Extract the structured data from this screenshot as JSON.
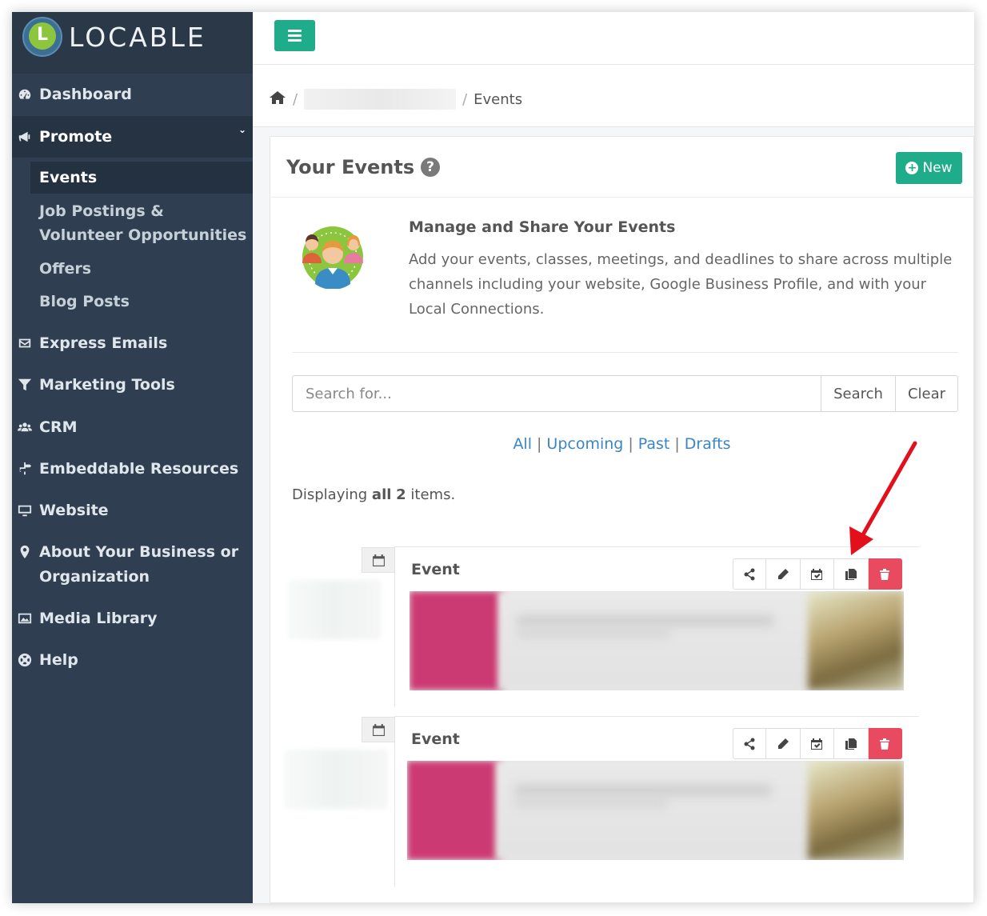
{
  "brand": {
    "name": "LOCABLE",
    "mark": "L"
  },
  "sidebar": {
    "dashboard": "Dashboard",
    "promote": "Promote",
    "promote_sub": [
      "Events",
      "Job Postings & Volunteer Opportunities",
      "Offers",
      "Blog Posts"
    ],
    "express_emails": "Express Emails",
    "marketing_tools": "Marketing Tools",
    "crm": "CRM",
    "embeddable": "Embeddable Resources",
    "website": "Website",
    "about": "About Your Business or Organization",
    "media": "Media Library",
    "help": "Help"
  },
  "breadcrumb": {
    "sep": "/",
    "current": "Events"
  },
  "panel": {
    "title": "Your Events",
    "help_glyph": "?",
    "new_label": "New",
    "intro_title": "Manage and Share Your Events",
    "intro_text": "Add your events, classes, meetings, and deadlines to share across multiple channels including your website, Google Business Profile, and with your Local Connections."
  },
  "search": {
    "placeholder": "Search for...",
    "search_label": "Search",
    "clear_label": "Clear"
  },
  "filters": [
    "All",
    "Upcoming",
    "Past",
    "Drafts"
  ],
  "display": {
    "prefix": "Displaying",
    "all": "all",
    "count": "2",
    "suffix": "items."
  },
  "events": [
    {
      "label": "Event"
    },
    {
      "label": "Event"
    }
  ],
  "colors": {
    "sidebar": "#2f3e50",
    "accent": "#1fac8b",
    "danger": "#e84a5f",
    "link": "#3a86c4",
    "arrow": "#e3101b"
  }
}
